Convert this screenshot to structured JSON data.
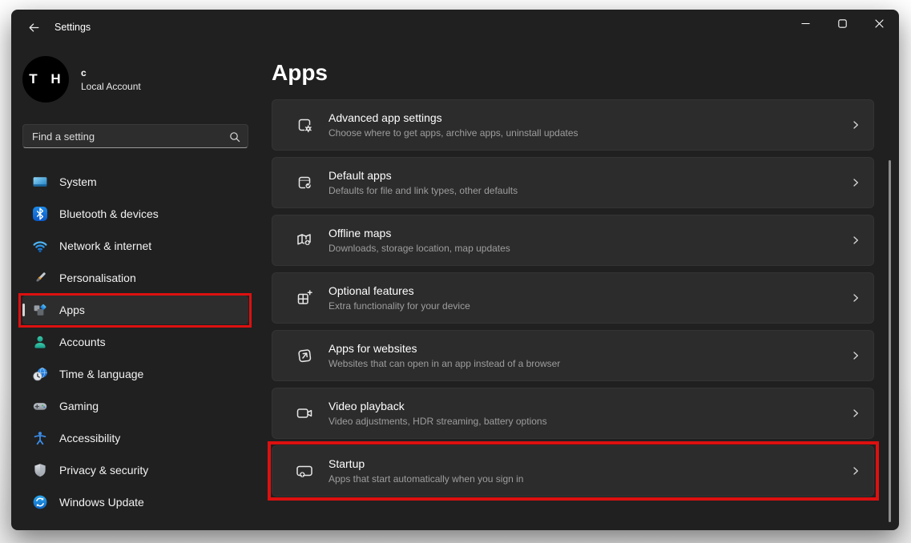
{
  "window": {
    "title": "Settings"
  },
  "sidebar": {
    "user": {
      "initials": "T H",
      "name": "c",
      "account_type": "Local Account"
    },
    "search": {
      "placeholder": "Find a setting"
    },
    "items": [
      {
        "label": "System",
        "icon": "system-icon"
      },
      {
        "label": "Bluetooth & devices",
        "icon": "bluetooth-icon"
      },
      {
        "label": "Network & internet",
        "icon": "network-internet-icon"
      },
      {
        "label": "Personalisation",
        "icon": "personalisation-icon"
      },
      {
        "label": "Apps",
        "icon": "apps-icon",
        "selected": true,
        "annotated": true
      },
      {
        "label": "Accounts",
        "icon": "accounts-icon"
      },
      {
        "label": "Time & language",
        "icon": "time-language-icon"
      },
      {
        "label": "Gaming",
        "icon": "gaming-icon"
      },
      {
        "label": "Accessibility",
        "icon": "accessibility-icon"
      },
      {
        "label": "Privacy & security",
        "icon": "privacy-security-icon"
      },
      {
        "label": "Windows Update",
        "icon": "windows-update-icon"
      }
    ]
  },
  "main": {
    "heading": "Apps",
    "cards": [
      {
        "title": "Advanced app settings",
        "description": "Choose where to get apps, archive apps, uninstall updates",
        "icon": "advanced-app-settings-icon"
      },
      {
        "title": "Default apps",
        "description": "Defaults for file and link types, other defaults",
        "icon": "default-apps-icon"
      },
      {
        "title": "Offline maps",
        "description": "Downloads, storage location, map updates",
        "icon": "offline-maps-icon"
      },
      {
        "title": "Optional features",
        "description": "Extra functionality for your device",
        "icon": "optional-features-icon"
      },
      {
        "title": "Apps for websites",
        "description": "Websites that can open in an app instead of a browser",
        "icon": "apps-for-websites-icon"
      },
      {
        "title": "Video playback",
        "description": "Video adjustments, HDR streaming, battery options",
        "icon": "video-playback-icon"
      },
      {
        "title": "Startup",
        "description": "Apps that start automatically when you sign in",
        "icon": "startup-icon",
        "annotated": true
      }
    ]
  },
  "annotations": {
    "highlight_color": "#dd1010",
    "highlighted_items": [
      "Apps sidebar item",
      "Startup card"
    ]
  },
  "colors": {
    "window_bg": "#202020",
    "card_bg": "#2c2c2c",
    "primary_text": "#ffffff",
    "secondary_text": "#9d9d9d"
  }
}
